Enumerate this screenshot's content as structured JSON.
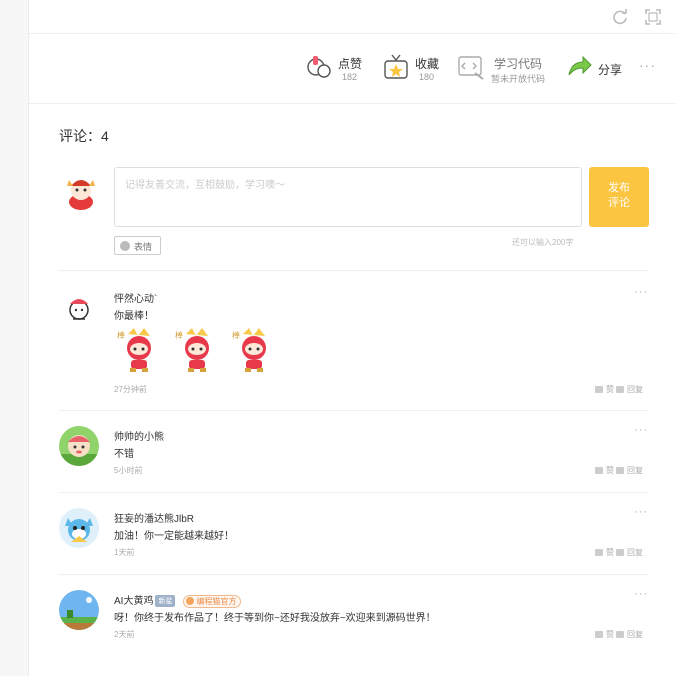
{
  "actions": {
    "like": {
      "label": "点赞",
      "count": "182"
    },
    "collect": {
      "label": "收藏",
      "count": "180"
    },
    "code": {
      "label": "学习代码",
      "sub": "暂未开放代码"
    },
    "share": {
      "label": "分享"
    },
    "more": "···"
  },
  "comments_title": "评论：4",
  "composer": {
    "placeholder": "记得友善交流，互相鼓励，学习噢～",
    "publish_label_line1": "发布",
    "publish_label_line2": "评论",
    "emoji_label": "表情",
    "char_hint": "还可以输入200字"
  },
  "comment_actions": {
    "like": "赞",
    "reply": "回复",
    "more": "···"
  },
  "comments": [
    {
      "user": "怦然心动`",
      "text": "你最棒！",
      "time": "27分钟前",
      "stickers": 3
    },
    {
      "user": "帅帅的小熊",
      "text": "不错",
      "time": "5小时前"
    },
    {
      "user": "狂妄的潘达熊JlbR",
      "text": "加油！你一定能越来越好！",
      "time": "1天前"
    },
    {
      "user": "AI大黄鸡",
      "badge_new": "新星",
      "badge_official": "编程猫官方",
      "text": "呀！你终于发布作品了！终于等到你~还好我没放弃~欢迎来到源码世界！",
      "time": "2天前"
    }
  ],
  "colors": {
    "publish_button": "#fcc541",
    "badge_official": "#e98a4a"
  }
}
